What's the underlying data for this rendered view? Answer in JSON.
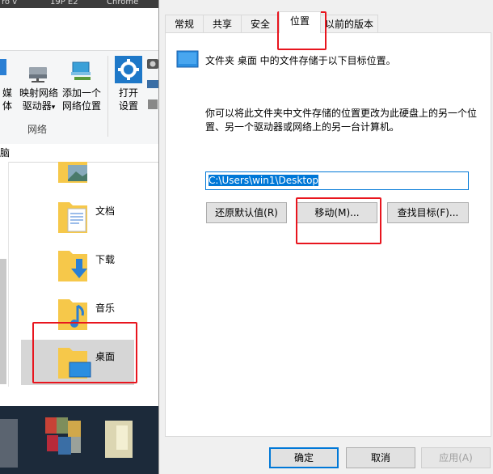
{
  "explorer": {
    "titlebar_frags": [
      "ro v",
      "19P E2",
      "Chrome"
    ],
    "ribbon": {
      "media_label": "媒体",
      "map_drive_label_1": "映射网络",
      "map_drive_label_2": "驱动器",
      "map_drive_arrow": "▾",
      "add_location_label_1": "添加一个",
      "add_location_label_2": "网络位置",
      "open_settings_label_1": "打开",
      "open_settings_label_2": "设置",
      "group_label": "网络"
    },
    "address_text": "脑",
    "items": [
      {
        "label": "文档"
      },
      {
        "label": "下载"
      },
      {
        "label": "音乐"
      },
      {
        "label": "桌面"
      }
    ]
  },
  "dialog": {
    "tabs": [
      "常规",
      "共享",
      "安全",
      "位置",
      "以前的版本"
    ],
    "active_tab": "位置",
    "description": "文件夹 桌面 中的文件存储于以下目标位置。",
    "help_text": "你可以将此文件夹中文件存储的位置更改为此硬盘上的另一个位置、另一个驱动器或网络上的另一台计算机。",
    "path_value": "C:\\Users\\win1\\Desktop",
    "restore_button": "还原默认值(R)",
    "move_button": "移动(M)...",
    "find_target_button": "查找目标(F)...",
    "ok_button": "确定",
    "cancel_button": "取消",
    "apply_button": "应用(A)"
  },
  "colors": {
    "accent": "#0078d7",
    "annotation_red": "#e8151e",
    "folder_yellow": "#f6c84a"
  }
}
